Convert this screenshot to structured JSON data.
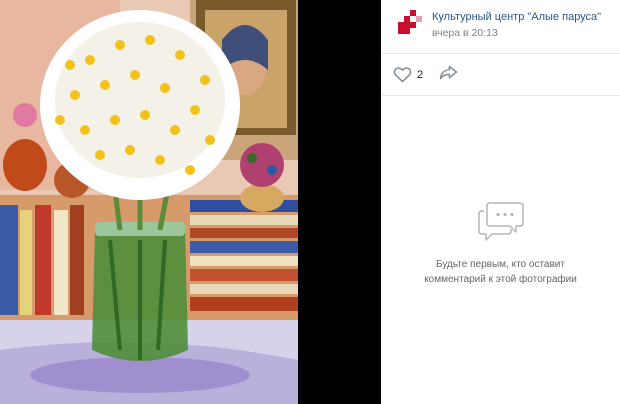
{
  "post": {
    "author_name": "Культурный центр \"Алые паруса\"",
    "time": "вчера в 20:13"
  },
  "actions": {
    "likes_count": "2"
  },
  "comments": {
    "empty_line1": "Будьте первым, кто оставит",
    "empty_line2": "комментарий к этой фотографии"
  },
  "icons": {
    "logo": "culture-center-logo",
    "like": "heart-icon",
    "share": "share-arrow-icon",
    "empty": "comments-bubble-icon"
  },
  "colors": {
    "link": "#2a5885",
    "secondary": "#828282",
    "logo_red": "#c8102e",
    "icon_gray": "#828a99"
  }
}
